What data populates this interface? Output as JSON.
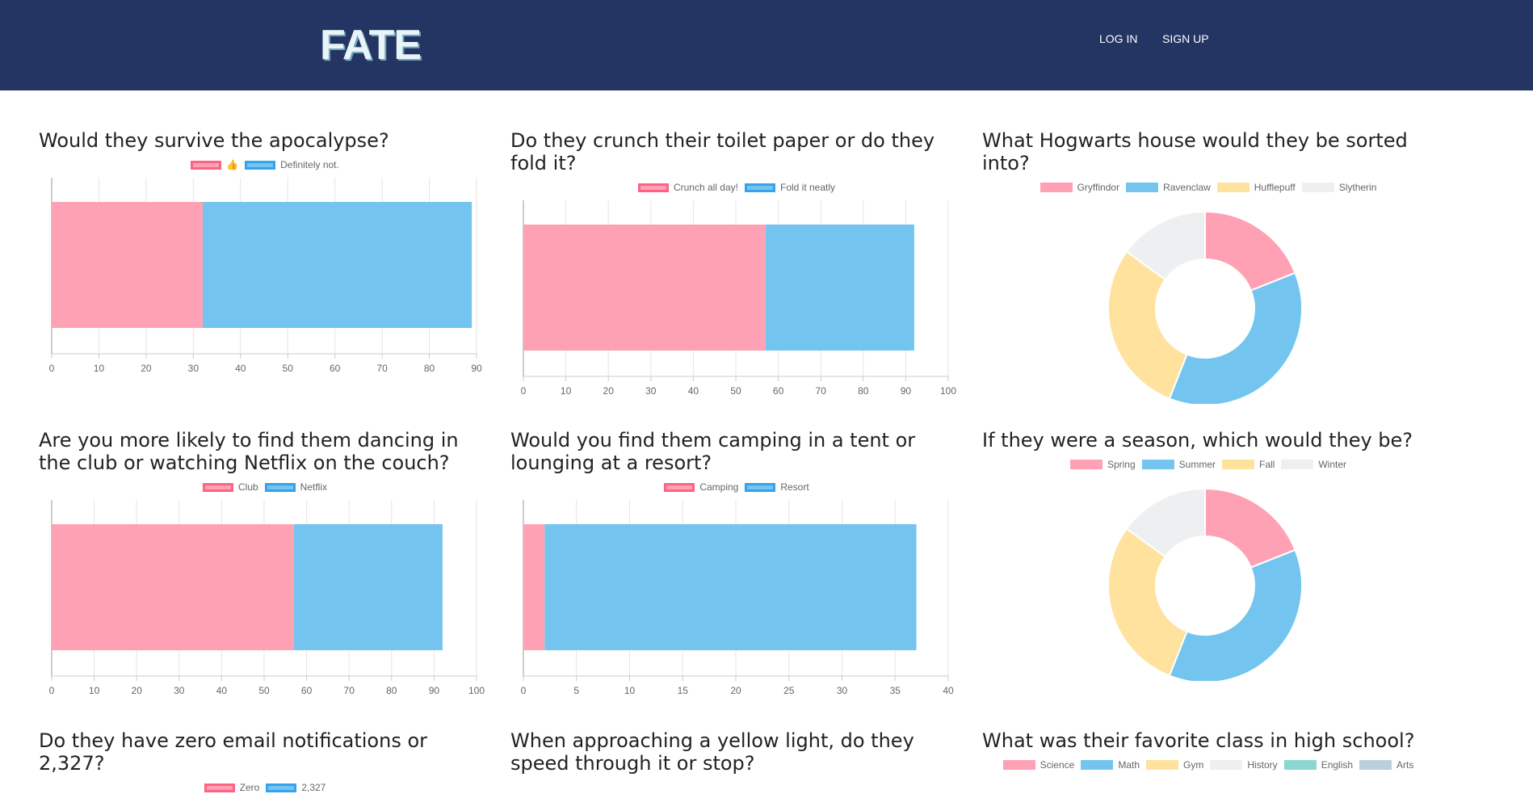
{
  "nav": {
    "logo": "FATE",
    "login": "LOG IN",
    "signup": "SIGN UP"
  },
  "colors": {
    "pink": "#ffa1b5",
    "pink_border": "#ff6384",
    "blue": "#73c5ef",
    "blue_border": "#36a2eb",
    "yellow": "#ffe29e",
    "light_gray": "#eeeff1",
    "teal": "#8ad7d1",
    "slate": "#b9d0dc"
  },
  "panels": [
    {
      "title": "Would they survive the apocalypse?",
      "legend": [
        {
          "label": "👍",
          "color": "pink"
        },
        {
          "label": "Definitely not.",
          "color": "blue"
        }
      ]
    },
    {
      "title": "Do they crunch their toilet paper or do they fold it?",
      "legend": [
        {
          "label": "Crunch all day!",
          "color": "pink"
        },
        {
          "label": "Fold it neatly",
          "color": "blue"
        }
      ]
    },
    {
      "title": "What Hogwarts house would they be sorted into?",
      "legend": [
        {
          "label": "Gryffindor",
          "color": "pink"
        },
        {
          "label": "Ravenclaw",
          "color": "blue"
        },
        {
          "label": "Hufflepuff",
          "color": "yellow"
        },
        {
          "label": "Slytherin",
          "color": "light_gray"
        }
      ]
    },
    {
      "title": "Are you more likely to find them dancing in the club or watching Netflix on the couch?",
      "legend": [
        {
          "label": "Club",
          "color": "pink"
        },
        {
          "label": "Netflix",
          "color": "blue"
        }
      ]
    },
    {
      "title": "Would you find them camping in a tent or lounging at a resort?",
      "legend": [
        {
          "label": "Camping",
          "color": "pink"
        },
        {
          "label": "Resort",
          "color": "blue"
        }
      ]
    },
    {
      "title": "If they were a season, which would they be?",
      "legend": [
        {
          "label": "Spring",
          "color": "pink"
        },
        {
          "label": "Summer",
          "color": "blue"
        },
        {
          "label": "Fall",
          "color": "yellow"
        },
        {
          "label": "Winter",
          "color": "light_gray"
        }
      ]
    },
    {
      "title": "Do they have zero email notifications or 2,327?",
      "legend": [
        {
          "label": "Zero",
          "color": "pink"
        },
        {
          "label": "2,327",
          "color": "blue"
        }
      ]
    },
    {
      "title": "When approaching a yellow light, do they speed through it or stop?",
      "legend": []
    },
    {
      "title": "What was their favorite class in high school?",
      "legend": [
        {
          "label": "Science",
          "color": "pink"
        },
        {
          "label": "Math",
          "color": "blue"
        },
        {
          "label": "Gym",
          "color": "yellow"
        },
        {
          "label": "History",
          "color": "light_gray"
        },
        {
          "label": "English",
          "color": "teal"
        },
        {
          "label": "Arts",
          "color": "slate"
        }
      ]
    }
  ],
  "chart_data": [
    {
      "type": "bar",
      "orientation": "horizontal-stacked",
      "series": [
        {
          "name": "👍",
          "values": [
            32
          ]
        },
        {
          "name": "Definitely not.",
          "values": [
            57
          ]
        }
      ],
      "xlim": [
        0,
        90
      ],
      "xticks": [
        "0",
        "10",
        "20",
        "30",
        "40",
        "50",
        "60",
        "70",
        "80",
        "90"
      ],
      "grid": true
    },
    {
      "type": "bar",
      "orientation": "horizontal-stacked",
      "series": [
        {
          "name": "Crunch all day!",
          "values": [
            57
          ]
        },
        {
          "name": "Fold it neatly",
          "values": [
            35
          ]
        }
      ],
      "xlim": [
        0,
        100
      ],
      "xticks": [
        "0",
        "10",
        "20",
        "30",
        "40",
        "50",
        "60",
        "70",
        "80",
        "90",
        "100"
      ],
      "grid": true
    },
    {
      "type": "pie",
      "style": "doughnut",
      "categories": [
        "Gryffindor",
        "Ravenclaw",
        "Hufflepuff",
        "Slytherin"
      ],
      "values": [
        19,
        37,
        29,
        15
      ]
    },
    {
      "type": "bar",
      "orientation": "horizontal-stacked",
      "series": [
        {
          "name": "Club",
          "values": [
            57
          ]
        },
        {
          "name": "Netflix",
          "values": [
            35
          ]
        }
      ],
      "xlim": [
        0,
        100
      ],
      "xticks": [
        "0",
        "10",
        "20",
        "30",
        "40",
        "50",
        "60",
        "70",
        "80",
        "90",
        "100"
      ],
      "grid": true
    },
    {
      "type": "bar",
      "orientation": "horizontal-stacked",
      "series": [
        {
          "name": "Camping",
          "values": [
            2
          ]
        },
        {
          "name": "Resort",
          "values": [
            35
          ]
        }
      ],
      "xlim": [
        0,
        40
      ],
      "xticks": [
        "0",
        "5",
        "10",
        "15",
        "20",
        "25",
        "30",
        "35",
        "40"
      ],
      "grid": true
    },
    {
      "type": "pie",
      "style": "doughnut",
      "categories": [
        "Spring",
        "Summer",
        "Fall",
        "Winter"
      ],
      "values": [
        19,
        37,
        29,
        15
      ]
    }
  ]
}
